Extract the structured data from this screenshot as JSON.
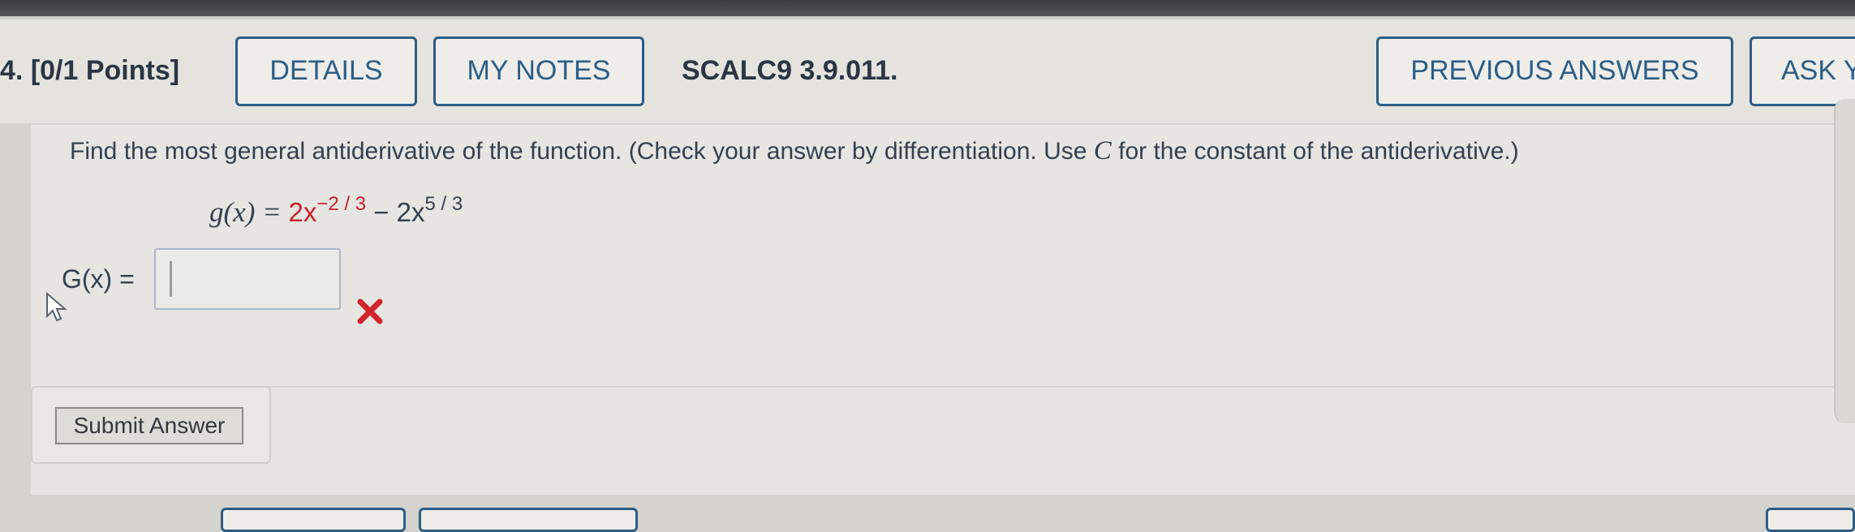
{
  "header": {
    "question_number": "4.",
    "points": "[0/1 Points]",
    "details_label": "DETAILS",
    "my_notes_label": "MY NOTES",
    "problem_code": "SCALC9 3.9.011.",
    "previous_answers_label": "PREVIOUS ANSWERS",
    "ask_label": "ASK Y"
  },
  "question": {
    "prompt_before": "Find the most general antiderivative of the function. (Check your answer by differentiation. Use ",
    "prompt_var": "C",
    "prompt_after": " for the constant of the antiderivative.)",
    "equation": {
      "lhs": "g(x) = ",
      "term1_coef": "2x",
      "term1_exp": "−2 / 3",
      "operator": " − 2x",
      "term2_exp": "5 / 3"
    },
    "answer_label": "G(x) =",
    "answer_value": "",
    "result": "incorrect"
  },
  "submit_label": "Submit Answer",
  "colors": {
    "accent": "#2c5d86",
    "error": "#c8202a",
    "background": "#e6e5e1"
  },
  "icons": {
    "wrong": "red-x-icon",
    "cursor": "mouse-pointer-icon"
  }
}
